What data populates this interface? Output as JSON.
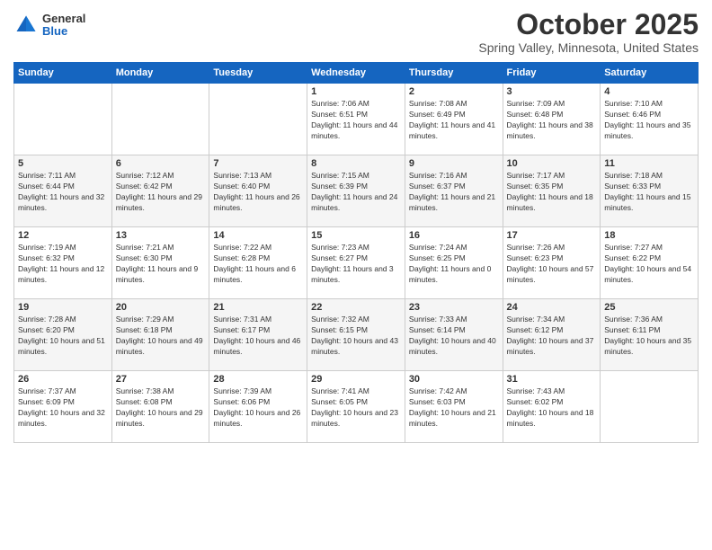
{
  "header": {
    "logo": {
      "general": "General",
      "blue": "Blue"
    },
    "title": "October 2025",
    "subtitle": "Spring Valley, Minnesota, United States"
  },
  "days_of_week": [
    "Sunday",
    "Monday",
    "Tuesday",
    "Wednesday",
    "Thursday",
    "Friday",
    "Saturday"
  ],
  "weeks": [
    [
      {
        "day": "",
        "sunrise": "",
        "sunset": "",
        "daylight": ""
      },
      {
        "day": "",
        "sunrise": "",
        "sunset": "",
        "daylight": ""
      },
      {
        "day": "",
        "sunrise": "",
        "sunset": "",
        "daylight": ""
      },
      {
        "day": "1",
        "sunrise": "Sunrise: 7:06 AM",
        "sunset": "Sunset: 6:51 PM",
        "daylight": "Daylight: 11 hours and 44 minutes."
      },
      {
        "day": "2",
        "sunrise": "Sunrise: 7:08 AM",
        "sunset": "Sunset: 6:49 PM",
        "daylight": "Daylight: 11 hours and 41 minutes."
      },
      {
        "day": "3",
        "sunrise": "Sunrise: 7:09 AM",
        "sunset": "Sunset: 6:48 PM",
        "daylight": "Daylight: 11 hours and 38 minutes."
      },
      {
        "day": "4",
        "sunrise": "Sunrise: 7:10 AM",
        "sunset": "Sunset: 6:46 PM",
        "daylight": "Daylight: 11 hours and 35 minutes."
      }
    ],
    [
      {
        "day": "5",
        "sunrise": "Sunrise: 7:11 AM",
        "sunset": "Sunset: 6:44 PM",
        "daylight": "Daylight: 11 hours and 32 minutes."
      },
      {
        "day": "6",
        "sunrise": "Sunrise: 7:12 AM",
        "sunset": "Sunset: 6:42 PM",
        "daylight": "Daylight: 11 hours and 29 minutes."
      },
      {
        "day": "7",
        "sunrise": "Sunrise: 7:13 AM",
        "sunset": "Sunset: 6:40 PM",
        "daylight": "Daylight: 11 hours and 26 minutes."
      },
      {
        "day": "8",
        "sunrise": "Sunrise: 7:15 AM",
        "sunset": "Sunset: 6:39 PM",
        "daylight": "Daylight: 11 hours and 24 minutes."
      },
      {
        "day": "9",
        "sunrise": "Sunrise: 7:16 AM",
        "sunset": "Sunset: 6:37 PM",
        "daylight": "Daylight: 11 hours and 21 minutes."
      },
      {
        "day": "10",
        "sunrise": "Sunrise: 7:17 AM",
        "sunset": "Sunset: 6:35 PM",
        "daylight": "Daylight: 11 hours and 18 minutes."
      },
      {
        "day": "11",
        "sunrise": "Sunrise: 7:18 AM",
        "sunset": "Sunset: 6:33 PM",
        "daylight": "Daylight: 11 hours and 15 minutes."
      }
    ],
    [
      {
        "day": "12",
        "sunrise": "Sunrise: 7:19 AM",
        "sunset": "Sunset: 6:32 PM",
        "daylight": "Daylight: 11 hours and 12 minutes."
      },
      {
        "day": "13",
        "sunrise": "Sunrise: 7:21 AM",
        "sunset": "Sunset: 6:30 PM",
        "daylight": "Daylight: 11 hours and 9 minutes."
      },
      {
        "day": "14",
        "sunrise": "Sunrise: 7:22 AM",
        "sunset": "Sunset: 6:28 PM",
        "daylight": "Daylight: 11 hours and 6 minutes."
      },
      {
        "day": "15",
        "sunrise": "Sunrise: 7:23 AM",
        "sunset": "Sunset: 6:27 PM",
        "daylight": "Daylight: 11 hours and 3 minutes."
      },
      {
        "day": "16",
        "sunrise": "Sunrise: 7:24 AM",
        "sunset": "Sunset: 6:25 PM",
        "daylight": "Daylight: 11 hours and 0 minutes."
      },
      {
        "day": "17",
        "sunrise": "Sunrise: 7:26 AM",
        "sunset": "Sunset: 6:23 PM",
        "daylight": "Daylight: 10 hours and 57 minutes."
      },
      {
        "day": "18",
        "sunrise": "Sunrise: 7:27 AM",
        "sunset": "Sunset: 6:22 PM",
        "daylight": "Daylight: 10 hours and 54 minutes."
      }
    ],
    [
      {
        "day": "19",
        "sunrise": "Sunrise: 7:28 AM",
        "sunset": "Sunset: 6:20 PM",
        "daylight": "Daylight: 10 hours and 51 minutes."
      },
      {
        "day": "20",
        "sunrise": "Sunrise: 7:29 AM",
        "sunset": "Sunset: 6:18 PM",
        "daylight": "Daylight: 10 hours and 49 minutes."
      },
      {
        "day": "21",
        "sunrise": "Sunrise: 7:31 AM",
        "sunset": "Sunset: 6:17 PM",
        "daylight": "Daylight: 10 hours and 46 minutes."
      },
      {
        "day": "22",
        "sunrise": "Sunrise: 7:32 AM",
        "sunset": "Sunset: 6:15 PM",
        "daylight": "Daylight: 10 hours and 43 minutes."
      },
      {
        "day": "23",
        "sunrise": "Sunrise: 7:33 AM",
        "sunset": "Sunset: 6:14 PM",
        "daylight": "Daylight: 10 hours and 40 minutes."
      },
      {
        "day": "24",
        "sunrise": "Sunrise: 7:34 AM",
        "sunset": "Sunset: 6:12 PM",
        "daylight": "Daylight: 10 hours and 37 minutes."
      },
      {
        "day": "25",
        "sunrise": "Sunrise: 7:36 AM",
        "sunset": "Sunset: 6:11 PM",
        "daylight": "Daylight: 10 hours and 35 minutes."
      }
    ],
    [
      {
        "day": "26",
        "sunrise": "Sunrise: 7:37 AM",
        "sunset": "Sunset: 6:09 PM",
        "daylight": "Daylight: 10 hours and 32 minutes."
      },
      {
        "day": "27",
        "sunrise": "Sunrise: 7:38 AM",
        "sunset": "Sunset: 6:08 PM",
        "daylight": "Daylight: 10 hours and 29 minutes."
      },
      {
        "day": "28",
        "sunrise": "Sunrise: 7:39 AM",
        "sunset": "Sunset: 6:06 PM",
        "daylight": "Daylight: 10 hours and 26 minutes."
      },
      {
        "day": "29",
        "sunrise": "Sunrise: 7:41 AM",
        "sunset": "Sunset: 6:05 PM",
        "daylight": "Daylight: 10 hours and 23 minutes."
      },
      {
        "day": "30",
        "sunrise": "Sunrise: 7:42 AM",
        "sunset": "Sunset: 6:03 PM",
        "daylight": "Daylight: 10 hours and 21 minutes."
      },
      {
        "day": "31",
        "sunrise": "Sunrise: 7:43 AM",
        "sunset": "Sunset: 6:02 PM",
        "daylight": "Daylight: 10 hours and 18 minutes."
      },
      {
        "day": "",
        "sunrise": "",
        "sunset": "",
        "daylight": ""
      }
    ]
  ]
}
